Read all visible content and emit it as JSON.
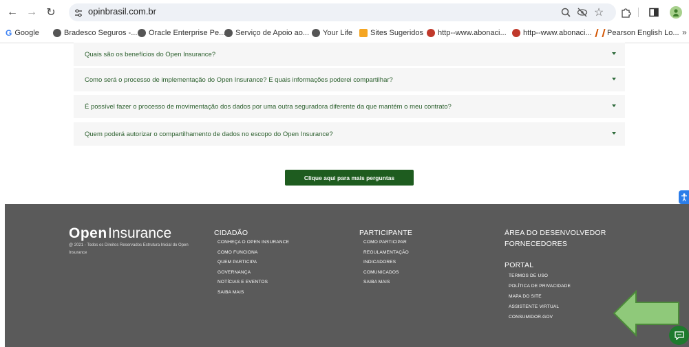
{
  "browser": {
    "url": "opinbrasil.com.br",
    "bookmarks": [
      {
        "label": "Google",
        "color": "#4285f4"
      },
      {
        "label": "Bradesco Seguros -...",
        "color": "#555555"
      },
      {
        "label": "Oracle Enterprise Pe...",
        "color": "#555555"
      },
      {
        "label": "Serviço de Apoio ao...",
        "color": "#555555"
      },
      {
        "label": "Your Life",
        "color": "#555555"
      },
      {
        "label": "Sites Sugeridos",
        "color": "#f5a623"
      },
      {
        "label": "http--www.abonaci...",
        "color": "#c0392b"
      },
      {
        "label": "http--www.abonaci...",
        "color": "#c0392b"
      },
      {
        "label": "Pearson English Lo...",
        "color": "#d35400"
      }
    ]
  },
  "faq": [
    {
      "question": "Quais são os benefícios do Open Insurance?"
    },
    {
      "question": "Como será o processo de implementação do Open Insurance? E quais informações poderei compartilhar?"
    },
    {
      "question": "É possível fazer o processo de movimentação dos dados por uma outra seguradora diferente da que mantém o meu contrato?"
    },
    {
      "question": "Quem poderá autorizar o compartilhamento de dados no escopo do Open Insurance?"
    }
  ],
  "more_button": "Clique aqui para mais perguntas",
  "footer": {
    "logo_open": "Open",
    "logo_insurance": "Insurance",
    "copyright": "@ 2021 - Todos os Direitos Reservados Estrutura Inicial do Open Insurance",
    "cidadao": {
      "title": "CIDADÃO",
      "links": [
        "CONHEÇA O OPEN INSURANCE",
        "COMO FUNCIONA",
        "QUEM PARTICIPA",
        "GOVERNANÇA",
        "NOTÍCIAS E EVENTOS",
        "SAIBA MAIS"
      ]
    },
    "participante": {
      "title": "PARTICIPANTE",
      "links": [
        "COMO PARTICIPAR",
        "REGULAMENTAÇÃO",
        "INDICADORES",
        "COMUNICADOS",
        "SAIBA MAIS"
      ]
    },
    "dev": {
      "title1": "ÁREA DO DESENVOLVEDOR",
      "title2": "FORNECEDORES",
      "portal_title": "PORTAL",
      "links": [
        "TERMOS DE USO",
        "POLÍTICA DE PRIVACIDADE",
        "MAPA DO SITE",
        "ASSISTENTE VIRTUAL",
        "CONSUMIDOR.GOV"
      ]
    }
  },
  "colors": {
    "accent_green": "#1e5c1f",
    "footer_bg": "#5a5a5a",
    "arrow_fill": "#8fc97a",
    "arrow_stroke": "#4c8a3a"
  }
}
